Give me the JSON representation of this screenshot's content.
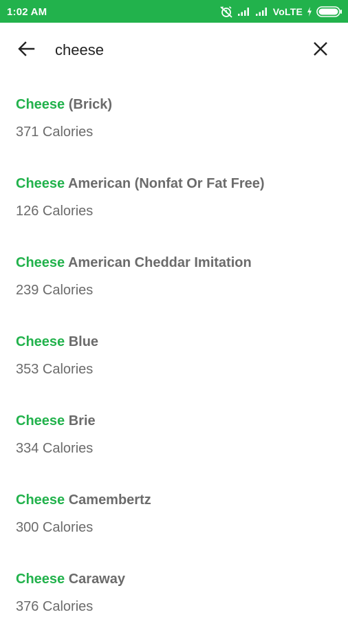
{
  "status_bar": {
    "time": "1:02 AM",
    "network_label": "VoLTE",
    "colors": {
      "background": "#22b24c",
      "text": "#ffffff"
    },
    "icons": [
      "alarm-off-icon",
      "signal-icon",
      "signal-icon",
      "charging-icon",
      "battery-icon"
    ]
  },
  "search": {
    "query": "cheese",
    "back_icon": "arrow-left-icon",
    "clear_icon": "close-icon"
  },
  "colors": {
    "accent": "#22b24c",
    "text_secondary": "#6b6b6b"
  },
  "results": [
    {
      "match": "Cheese",
      "rest": " (Brick)",
      "calories": "371 Calories"
    },
    {
      "match": "Cheese",
      "rest": " American (Nonfat Or Fat Free)",
      "calories": "126 Calories"
    },
    {
      "match": "Cheese",
      "rest": " American Cheddar Imitation",
      "calories": "239 Calories"
    },
    {
      "match": "Cheese",
      "rest": " Blue",
      "calories": "353 Calories"
    },
    {
      "match": "Cheese",
      "rest": " Brie",
      "calories": "334 Calories"
    },
    {
      "match": "Cheese",
      "rest": " Camembertz",
      "calories": "300 Calories"
    },
    {
      "match": "Cheese",
      "rest": " Caraway",
      "calories": "376 Calories"
    }
  ]
}
